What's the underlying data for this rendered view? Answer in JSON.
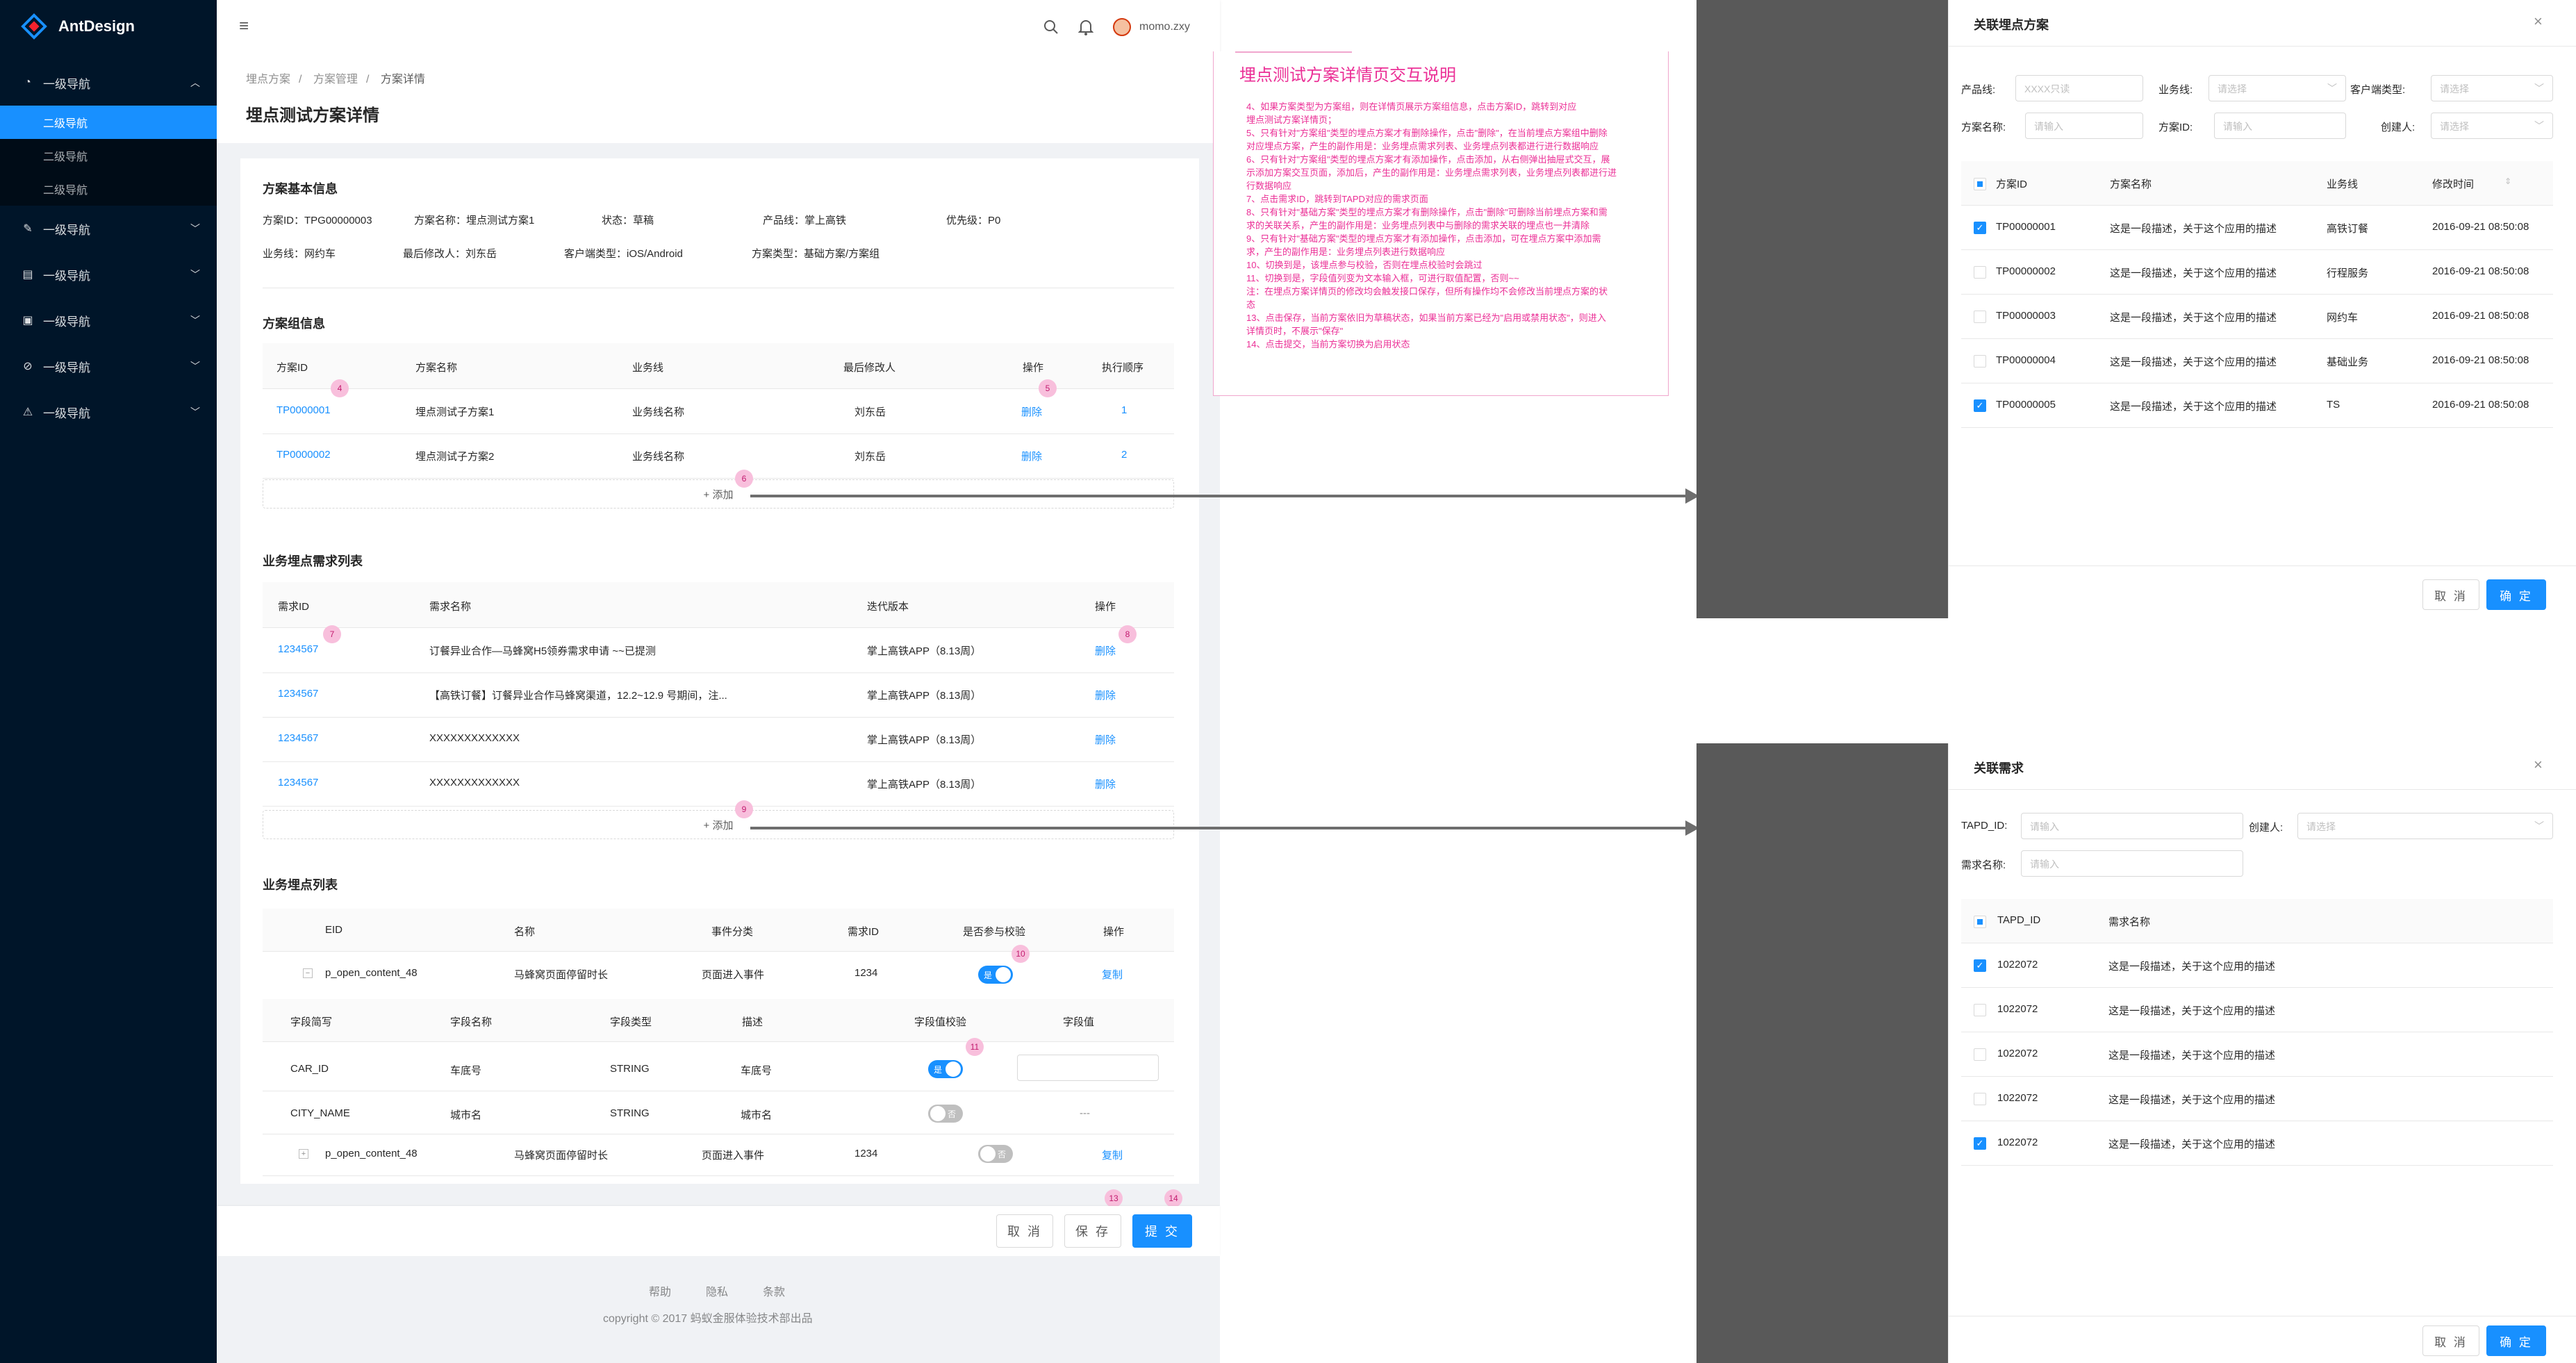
{
  "app": {
    "name": "AntDesign"
  },
  "sidebar": {
    "group1": "一级导航",
    "items": [
      "二级导航",
      "二级导航",
      "二级导航"
    ],
    "groups": [
      "一级导航",
      "一级导航",
      "一级导航",
      "一级导航",
      "一级导航"
    ]
  },
  "header": {
    "user": "momo.zxy"
  },
  "breadcrumb": [
    "埋点方案",
    "方案管理",
    "方案详情"
  ],
  "page_title": "埋点测试方案详情",
  "basic": {
    "title": "方案基本信息",
    "id": "方案ID：TPG00000003",
    "name": "方案名称：埋点测试方案1",
    "status": "状态：草稿",
    "product": "产品线：掌上高铁",
    "priority": "优先级：P0",
    "biz": "业务线：网约车",
    "modifier": "最后修改人：刘东岳",
    "client": "客户端类型：iOS/Android",
    "type": "方案类型：基础方案/方案组"
  },
  "group": {
    "title": "方案组信息",
    "headers": [
      "方案ID",
      "方案名称",
      "业务线",
      "最后修改人",
      "操作",
      "执行顺序"
    ],
    "rows": [
      [
        "TP0000001",
        "埋点测试子方案1",
        "业务线名称",
        "刘东岳",
        "删除",
        "1"
      ],
      [
        "TP0000002",
        "埋点测试子方案2",
        "业务线名称",
        "刘东岳",
        "删除",
        "2"
      ]
    ],
    "add": "+ 添加"
  },
  "req": {
    "title": "业务埋点需求列表",
    "headers": [
      "需求ID",
      "需求名称",
      "迭代版本",
      "操作"
    ],
    "rows": [
      [
        "1234567",
        "订餐异业合作—马蜂窝H5领券需求申请 ~~已提测",
        "掌上高铁APP（8.13周）",
        "删除"
      ],
      [
        "1234567",
        "【高铁订餐】订餐异业合作马蜂窝渠道，12.2~12.9 号期间，注...",
        "掌上高铁APP（8.13周）",
        "删除"
      ],
      [
        "1234567",
        "XXXXXXXXXXXXX",
        "掌上高铁APP（8.13周）",
        "删除"
      ],
      [
        "1234567",
        "XXXXXXXXXXXXX",
        "掌上高铁APP（8.13周）",
        "删除"
      ]
    ],
    "add": "+ 添加"
  },
  "events": {
    "title": "业务埋点列表",
    "headers": [
      "EID",
      "名称",
      "事件分类",
      "需求ID",
      "是否参与校验",
      "操作"
    ],
    "row1": [
      "p_open_content_48",
      "马蜂窝页面停留时长",
      "页面进入事件",
      "1234",
      "复制"
    ],
    "sub_headers": [
      "字段简写",
      "字段名称",
      "字段类型",
      "描述",
      "字段值校验",
      "字段值"
    ],
    "sub_rows": [
      [
        "CAR_ID",
        "车底号",
        "STRING",
        "车底号"
      ],
      [
        "CITY_NAME",
        "城市名",
        "STRING",
        "城市名",
        "---"
      ]
    ],
    "row2": [
      "p_open_content_48",
      "马蜂窝页面停留时长",
      "页面进入事件",
      "1234",
      "复制"
    ],
    "toggle_on": "是",
    "toggle_off": "否"
  },
  "actions": {
    "cancel": "取 消",
    "save": "保 存",
    "submit": "提 交"
  },
  "footer": {
    "links": [
      "帮助",
      "隐私",
      "条款"
    ],
    "copyright": "copyright © 2017 蚂蚁金服体验技术部出品"
  },
  "pins": [
    "4",
    "5",
    "6",
    "7",
    "8",
    "9",
    "10",
    "11",
    "13",
    "14"
  ],
  "notes": {
    "title": "埋点测试方案详情页交互说明",
    "lines": [
      "4、如果方案类型为方案组，则在详情页展示方案组信息，点击方案ID，跳转到对应",
      "埋点测试方案详情页；",
      "5、只有针对\"方案组\"类型的埋点方案才有删除操作，点击\"删除\"，在当前埋点方案组中删除",
      "对应埋点方案，产生的副作用是：业务埋点需求列表、业务埋点列表都进行进行数据响应",
      "6、只有针对\"方案组\"类型的埋点方案才有添加操作，点击添加，从右侧弹出抽屉式交互，展",
      "示添加方案交互页面，添加后，产生的副作用是：业务埋点需求列表，业务埋点列表都进行进",
      "行数据响应",
      "7、点击需求ID，跳转到TAPD对应的需求页面",
      "8、只有针对\"基础方案\"类型的埋点方案才有删除操作，点击\"删除\"可删除当前埋点方案和需",
      "求的关联关系，产生的副作用是：业务埋点列表中与删除的需求关联的埋点也一并清除",
      "9、只有针对\"基础方案\"类型的埋点方案才有添加操作，点击添加，可在埋点方案中添加需",
      "求，产生的副作用是：业务埋点列表进行数据响应",
      "10、切换到是，该埋点参与校验，否则在埋点校验时会跳过",
      "11、切换到是，字段值列变为文本输入框，可进行取值配置，否则~~",
      "注：在埋点方案详情页的修改均会触发接口保存，但所有操作均不会修改当前埋点方案的状",
      "态",
      "13、点击保存，当前方案依旧为草稿状态，如果当前方案已经为\"启用或禁用状态\"，则进入",
      "详情页时，不展示\"保存\"",
      "14、点击提交，当前方案切换为启用状态"
    ]
  },
  "modal1": {
    "title": "关联埋点方案",
    "labels": [
      "产品线:",
      "业务线:",
      "客户端类型:",
      "方案名称:",
      "方案ID:",
      "创建人:"
    ],
    "placeholders": [
      "XXXX只读",
      "请选择",
      "请选择",
      "请输入",
      "请输入",
      "请选择"
    ],
    "headers": [
      "方案ID",
      "方案名称",
      "业务线",
      "修改时间"
    ],
    "rows": [
      {
        "id": "TP00000001",
        "desc": "这是一段描述，关于这个应用的描述",
        "biz": "高铁订餐",
        "time": "2016-09-21  08:50:08",
        "checked": true
      },
      {
        "id": "TP00000002",
        "desc": "这是一段描述，关于这个应用的描述",
        "biz": "行程服务",
        "time": "2016-09-21  08:50:08",
        "checked": false
      },
      {
        "id": "TP00000003",
        "desc": "这是一段描述，关于这个应用的描述",
        "biz": "网约车",
        "time": "2016-09-21  08:50:08",
        "checked": false
      },
      {
        "id": "TP00000004",
        "desc": "这是一段描述，关于这个应用的描述",
        "biz": "基础业务",
        "time": "2016-09-21  08:50:08",
        "checked": false
      },
      {
        "id": "TP00000005",
        "desc": "这是一段描述，关于这个应用的描述",
        "biz": "TS",
        "time": "2016-09-21  08:50:08",
        "checked": true
      }
    ],
    "cancel": "取 消",
    "ok": "确 定"
  },
  "modal2": {
    "title": "关联需求",
    "labels": [
      "TAPD_ID:",
      "创建人:",
      "需求名称:"
    ],
    "placeholders": [
      "请输入",
      "请选择",
      "请输入"
    ],
    "headers": [
      "TAPD_ID",
      "需求名称"
    ],
    "rows": [
      {
        "id": "1022072",
        "desc": "这是一段描述，关于这个应用的描述",
        "checked": true
      },
      {
        "id": "1022072",
        "desc": "这是一段描述，关于这个应用的描述",
        "checked": false
      },
      {
        "id": "1022072",
        "desc": "这是一段描述，关于这个应用的描述",
        "checked": false
      },
      {
        "id": "1022072",
        "desc": "这是一段描述，关于这个应用的描述",
        "checked": false
      },
      {
        "id": "1022072",
        "desc": "这是一段描述，关于这个应用的描述",
        "checked": true
      }
    ],
    "cancel": "取 消",
    "ok": "确 定"
  },
  "colors": {
    "primary": "#1890ff",
    "sider": "#001529",
    "note": "#eb2f96",
    "overlay": "#595959"
  }
}
